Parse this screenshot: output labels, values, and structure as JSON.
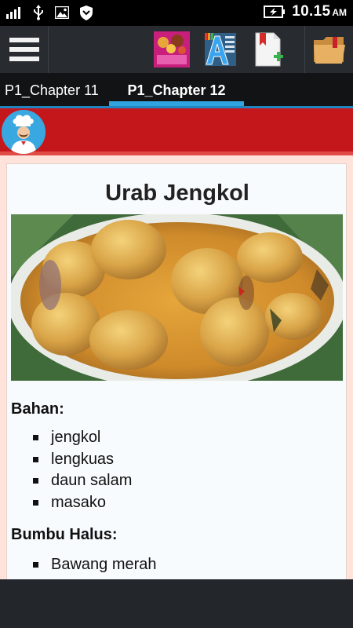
{
  "status_bar": {
    "time": "10.15",
    "ampm": "AM",
    "icons": [
      "signal-icon",
      "usb-icon",
      "image-icon",
      "shield-icon",
      "battery-charging-icon"
    ]
  },
  "toolbar": {
    "icons": [
      "menu-icon",
      "book-cover-icon",
      "font-size-icon",
      "add-bookmark-icon",
      "folder-bookmark-icon"
    ],
    "book_cover_text": "Resep Masakan"
  },
  "tabs": [
    {
      "label": "P1_Chapter 11",
      "active": false
    },
    {
      "label": "P1_Chapter 12",
      "active": true
    }
  ],
  "colors": {
    "banner": "#c4171c",
    "tab_accent": "#2fa4de",
    "content_bg": "#f8fbfd"
  },
  "recipe": {
    "title": "Urab Jengkol",
    "bahan_label": "Bahan:",
    "bahan": [
      "jengkol",
      "lengkuas",
      "daun salam",
      "masako"
    ],
    "bumbu_label": "Bumbu Halus:",
    "bumbu": [
      "Bawang merah"
    ]
  }
}
